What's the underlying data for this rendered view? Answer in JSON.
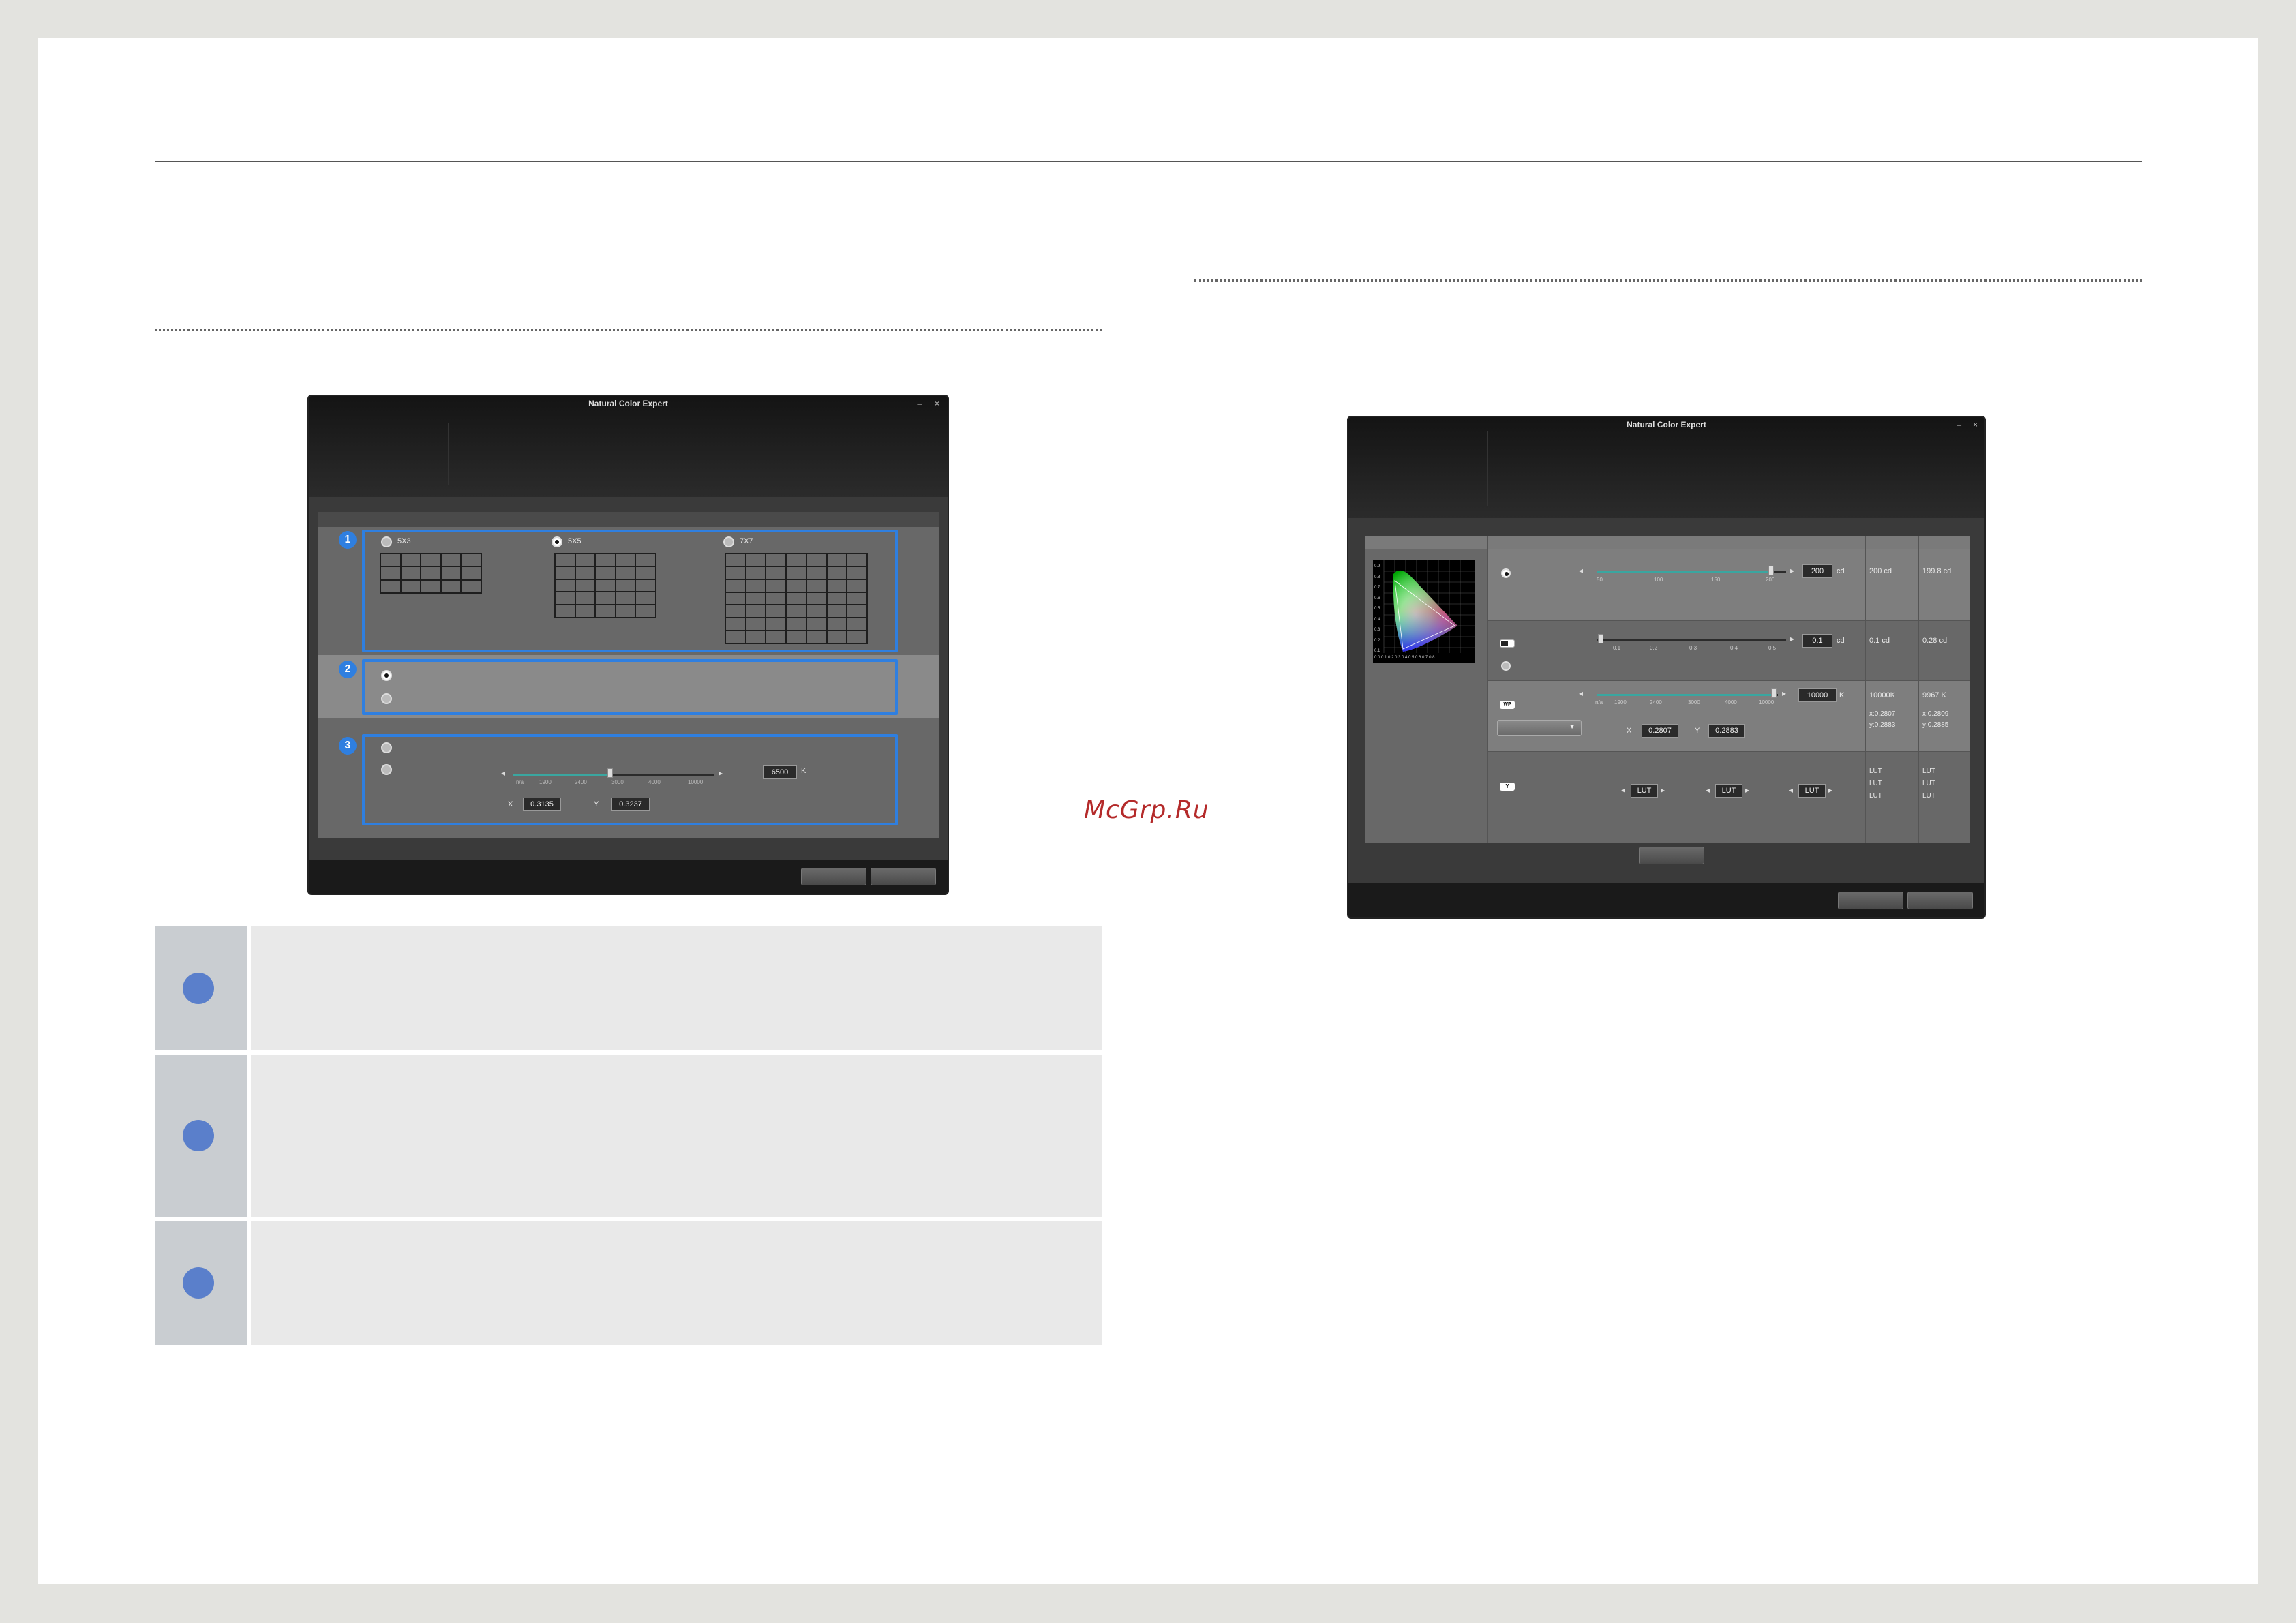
{
  "watermark": "McGrp.Ru",
  "window_left": {
    "title": "Natural Color Expert",
    "minimize": "–",
    "close": "×",
    "section1": {
      "badge": "1",
      "options": [
        {
          "label": "5X3",
          "selected": false
        },
        {
          "label": "5X5",
          "selected": true
        },
        {
          "label": "7X7",
          "selected": false
        }
      ]
    },
    "section2": {
      "badge": "2"
    },
    "section3": {
      "badge": "3",
      "slider_ticks": [
        "n/a",
        "1900",
        "2400",
        "3000",
        "4000",
        "10000"
      ],
      "slider_ticks_mid": "5000",
      "kelvin_value": "6500",
      "kelvin_unit": "K",
      "x_label": "X",
      "x_value": "0.3135",
      "y_label": "Y",
      "y_value": "0.3237"
    }
  },
  "window_right": {
    "title": "Natural Color Expert",
    "minimize": "–",
    "close": "×",
    "row_luminance": {
      "ticks": [
        "50",
        "100",
        "150",
        "200"
      ],
      "value": "200",
      "unit": "cd",
      "target": "200 cd",
      "measured": "199.8 cd"
    },
    "row_black": {
      "ticks": [
        "0.1",
        "0.2",
        "0.3",
        "0.4",
        "0.5"
      ],
      "value": "0.1",
      "unit": "cd",
      "target": "0.1 cd",
      "measured": "0.28 cd"
    },
    "row_white": {
      "icon_label": "WP",
      "ticks": [
        "n/a",
        "1900",
        "2400",
        "3000",
        "4000",
        "10000"
      ],
      "value": "10000",
      "unit": "K",
      "target": "10000K",
      "measured": "9967 K",
      "target_x": "x:0.2807",
      "target_y": "y:0.2883",
      "measured_x": "x:0.2809",
      "measured_y": "y:0.2885",
      "x_label": "X",
      "x_value": "0.2807",
      "y_label": "Y",
      "y_value": "0.2883"
    },
    "row_gamma": {
      "icon_label": "Y",
      "lut_buttons": [
        "LUT",
        "LUT",
        "LUT"
      ],
      "target": [
        "LUT",
        "LUT",
        "LUT"
      ],
      "measured": [
        "LUT",
        "LUT",
        "LUT"
      ]
    },
    "cie_axis_y": [
      "0.9",
      "0.8",
      "0.7",
      "0.6",
      "0.5",
      "0.4",
      "0.3",
      "0.2",
      "0.1"
    ],
    "cie_axis_x": "0.0 0.1 0.2 0.3 0.4 0.5 0.6 0.7 0.8"
  },
  "table_rows": [
    {
      "id": "row-1"
    },
    {
      "id": "row-2"
    },
    {
      "id": "row-3"
    }
  ]
}
